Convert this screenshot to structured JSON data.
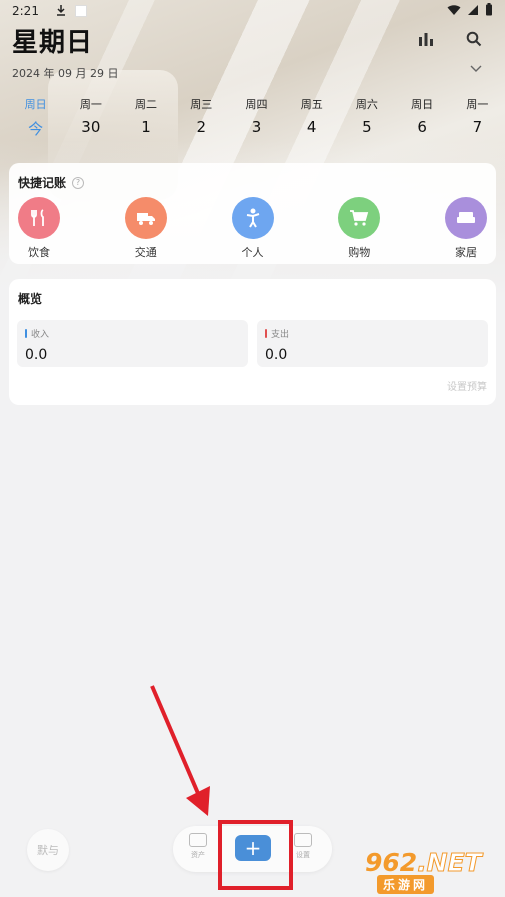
{
  "status_bar": {
    "time": "2:21"
  },
  "header": {
    "weekday": "星期日",
    "date": "2024 年 09 月 29 日"
  },
  "icons": {
    "chart": "bar-chart-icon",
    "search": "search-icon",
    "expand": "chevron-down-icon"
  },
  "week": [
    {
      "label": "周日",
      "num": "今",
      "active": true
    },
    {
      "label": "周一",
      "num": "30"
    },
    {
      "label": "周二",
      "num": "1"
    },
    {
      "label": "周三",
      "num": "2"
    },
    {
      "label": "周四",
      "num": "3"
    },
    {
      "label": "周五",
      "num": "4"
    },
    {
      "label": "周六",
      "num": "5"
    },
    {
      "label": "周日",
      "num": "6"
    },
    {
      "label": "周一",
      "num": "7"
    }
  ],
  "quick": {
    "title": "快捷记账",
    "items": [
      {
        "label": "饮食",
        "color": "#f07c87",
        "icon": "fork-knife-icon"
      },
      {
        "label": "交通",
        "color": "#f58c6a",
        "icon": "truck-icon"
      },
      {
        "label": "个人",
        "color": "#6ea6f0",
        "icon": "person-icon"
      },
      {
        "label": "购物",
        "color": "#7dd07e",
        "icon": "cart-icon"
      },
      {
        "label": "家居",
        "color": "#a98fdc",
        "icon": "sofa-icon"
      }
    ]
  },
  "overview": {
    "title": "概览",
    "income_label": "收入",
    "income_value": "0.0",
    "expense_label": "支出",
    "expense_value": "0.0",
    "budget_link": "设置预算",
    "income_color": "#3f8fe0",
    "expense_color": "#e05050"
  },
  "bottom": {
    "left_label": "默与",
    "assets_label": "资产",
    "add_label": "+",
    "settings_label": "设置"
  },
  "watermark": {
    "main": "962",
    "net": ".NET",
    "sub": "乐游网"
  }
}
